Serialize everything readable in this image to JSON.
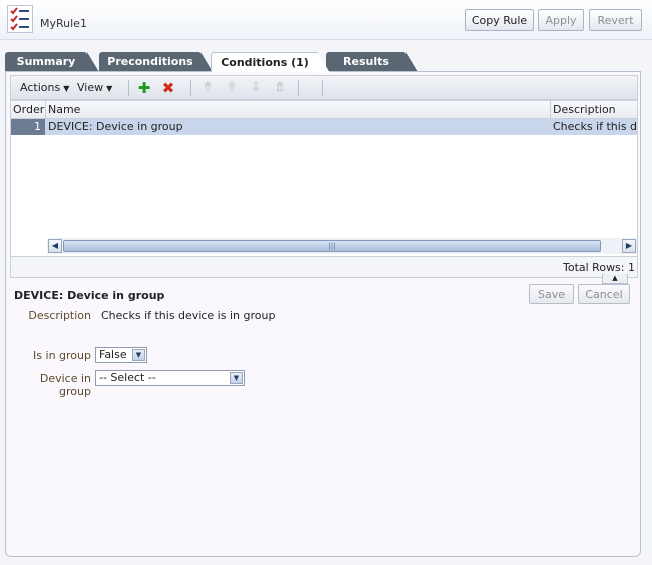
{
  "header": {
    "rule_name": "MyRule1",
    "copy_rule_label": "Copy Rule",
    "apply_label": "Apply",
    "revert_label": "Revert"
  },
  "tabs": [
    {
      "label": "Summary",
      "active": false
    },
    {
      "label": "Preconditions",
      "active": false
    },
    {
      "label": "Conditions (1)",
      "active": true
    },
    {
      "label": "Results",
      "active": false
    }
  ],
  "toolbar": {
    "actions_label": "Actions",
    "view_label": "View",
    "icons": [
      "add-icon",
      "delete-icon",
      "move-top-icon",
      "move-up-icon",
      "move-down-icon",
      "move-bottom-icon"
    ]
  },
  "table": {
    "columns": [
      "Order",
      "Name",
      "Description"
    ],
    "rows": [
      {
        "order": "1",
        "name": "DEVICE: Device in group",
        "description": "Checks if this device is in group"
      }
    ],
    "total_rows": "Total Rows: 1"
  },
  "detail": {
    "title": "DEVICE: Device in group",
    "save_label": "Save",
    "cancel_label": "Cancel",
    "description_label": "Description",
    "description_value": "Checks if this device is in group",
    "is_in_group_label": "Is in group",
    "is_in_group_value": "False",
    "device_in_group_label": "Device in group",
    "device_in_group_value": "-- Select --"
  },
  "colors": {
    "selected_row": "#c9d5ea",
    "tab_inactive": "#5b6673",
    "add_icon": "#1c9a1c",
    "delete_icon": "#d42a1e"
  }
}
